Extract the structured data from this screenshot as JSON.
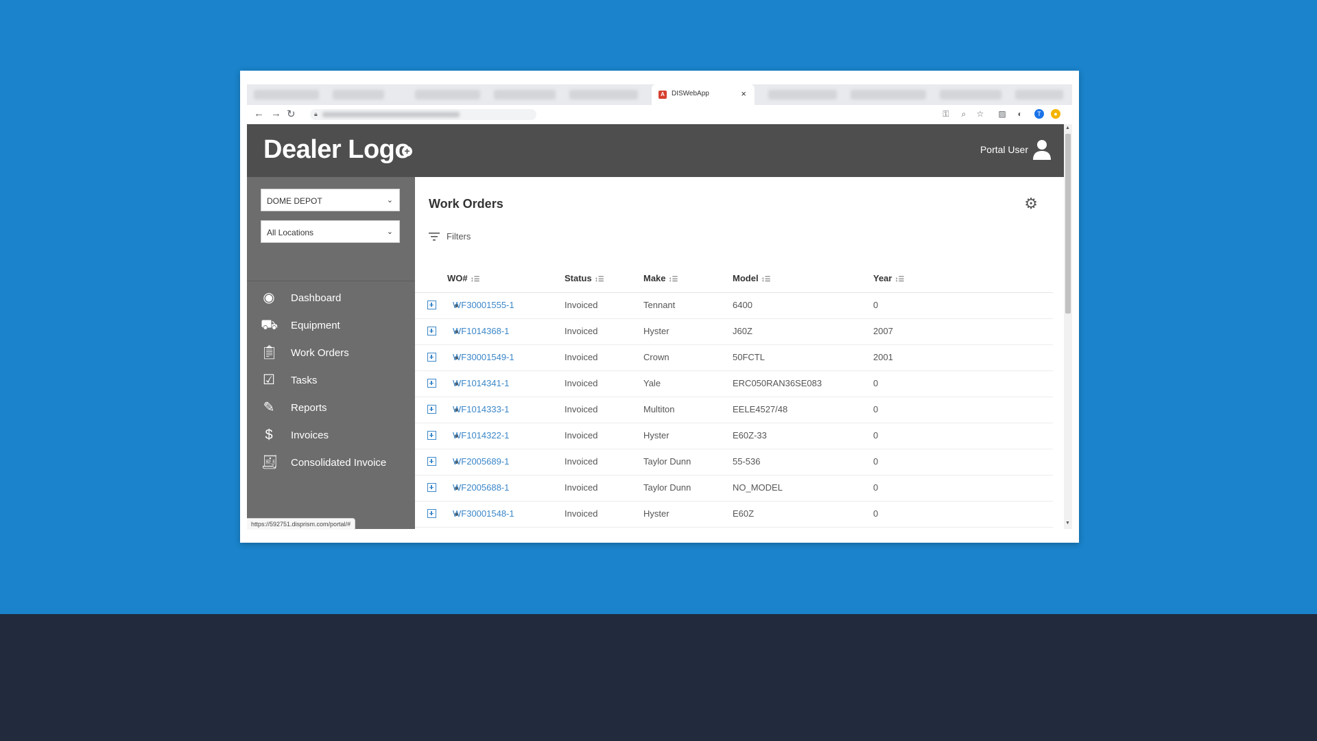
{
  "browser": {
    "active_tab_title": "DISWebApp",
    "status_url": "https://592751.disprism.com/portal/#"
  },
  "header": {
    "logo": "Dealer Logo",
    "user_name": "Portal User"
  },
  "sidebar": {
    "dealer_select": "DOME DEPOT",
    "location_select": "All Locations",
    "items": [
      {
        "label": "Dashboard",
        "icon": "eye-icon"
      },
      {
        "label": "Equipment",
        "icon": "forklift-icon"
      },
      {
        "label": "Work Orders",
        "icon": "clipboard-wrench-icon"
      },
      {
        "label": "Tasks",
        "icon": "checkbox-icon"
      },
      {
        "label": "Reports",
        "icon": "report-edit-icon"
      },
      {
        "label": "Invoices",
        "icon": "invoice-icon"
      },
      {
        "label": "Consolidated Invoice",
        "icon": "stacked-receipt-icon"
      }
    ]
  },
  "main": {
    "title": "Work Orders",
    "filters_label": "Filters",
    "columns": [
      "WO#",
      "Status",
      "Make",
      "Model",
      "Year"
    ],
    "rows": [
      {
        "wo": "WF30001555-1",
        "status": "Invoiced",
        "make": "Tennant",
        "model": "6400",
        "year": "0"
      },
      {
        "wo": "WF1014368-1",
        "status": "Invoiced",
        "make": "Hyster",
        "model": "J60Z",
        "year": "2007"
      },
      {
        "wo": "WF30001549-1",
        "status": "Invoiced",
        "make": "Crown",
        "model": "50FCTL",
        "year": "2001"
      },
      {
        "wo": "WF1014341-1",
        "status": "Invoiced",
        "make": "Yale",
        "model": "ERC050RAN36SE083",
        "year": "0"
      },
      {
        "wo": "WF1014333-1",
        "status": "Invoiced",
        "make": "Multiton",
        "model": "EELE4527/48",
        "year": "0"
      },
      {
        "wo": "WF1014322-1",
        "status": "Invoiced",
        "make": "Hyster",
        "model": "E60Z-33",
        "year": "0"
      },
      {
        "wo": "WF2005689-1",
        "status": "Invoiced",
        "make": "Taylor Dunn",
        "model": "55-536",
        "year": "0"
      },
      {
        "wo": "WF2005688-1",
        "status": "Invoiced",
        "make": "Taylor Dunn",
        "model": "NO_MODEL",
        "year": "0"
      },
      {
        "wo": "WF30001548-1",
        "status": "Invoiced",
        "make": "Hyster",
        "model": "E60Z",
        "year": "0"
      }
    ]
  },
  "colors": {
    "background_blue": "#1a83cb",
    "background_navy": "#212b3d",
    "header_gray": "#4e4e4e",
    "sidebar_gray": "#6d6d6d",
    "link_blue": "#3a86c8"
  }
}
